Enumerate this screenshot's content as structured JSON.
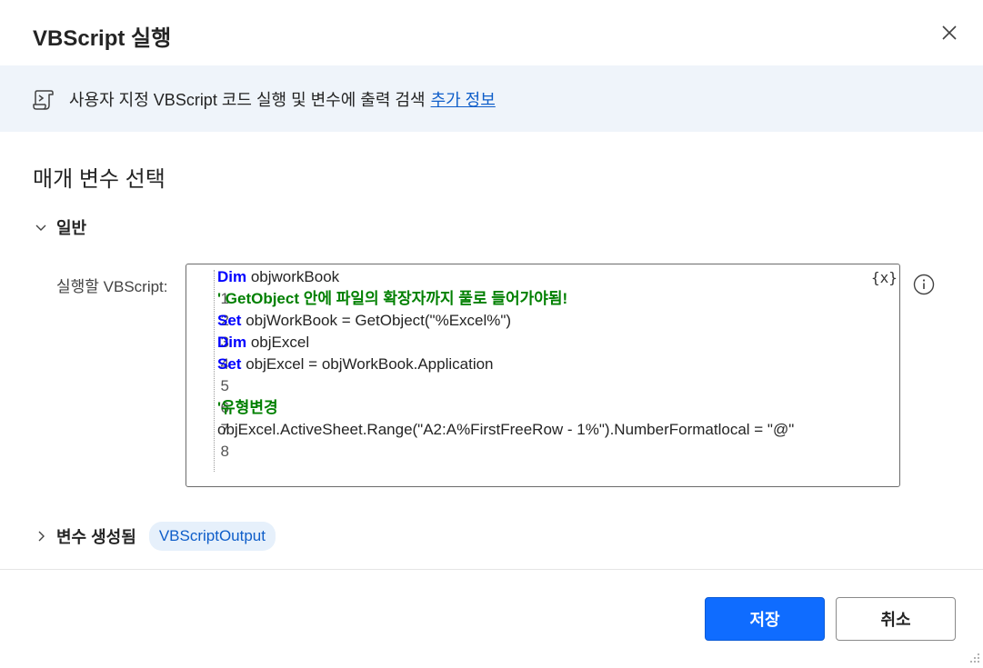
{
  "dialog": {
    "title": "VBScript 실행",
    "close_icon": "close-icon"
  },
  "info": {
    "icon": "script-icon",
    "text": "사용자 지정 VBScript 코드 실행 및 변수에 출력 검색",
    "link": "추가 정보"
  },
  "section_title": "매개 변수 선택",
  "general": {
    "label": "일반",
    "expanded": true,
    "field_label": "실행할 VBScript:",
    "variable_button": "{x}",
    "help_icon": "info-icon",
    "code_lines": [
      {
        "num": "1",
        "kw": "Dim",
        "rest": " objworkBook",
        "comment": ""
      },
      {
        "num": "2",
        "kw": "",
        "rest": "",
        "comment": "' GetObject 안에 파일의 확장자까지 풀로 들어가야됨!"
      },
      {
        "num": "3",
        "kw": "Set",
        "rest": " objWorkBook = GetObject(\"%Excel%\")",
        "comment": ""
      },
      {
        "num": "4",
        "kw": "Dim",
        "rest": " objExcel",
        "comment": ""
      },
      {
        "num": "5",
        "kw": "Set",
        "rest": " objExcel = objWorkBook.Application",
        "comment": ""
      },
      {
        "num": "6",
        "kw": "",
        "rest": "",
        "comment": ""
      },
      {
        "num": "7",
        "kw": "",
        "rest": "",
        "comment": "'유형변경"
      },
      {
        "num": "8",
        "kw": "",
        "rest": "objExcel.ActiveSheet.Range(\"A2:A%FirstFreeRow - 1%\").NumberFormatlocal = \"@\"",
        "comment": ""
      }
    ]
  },
  "variables": {
    "label": "변수 생성됨",
    "expanded": false,
    "chip": "VBScriptOutput"
  },
  "buttons": {
    "save": "저장",
    "cancel": "취소"
  },
  "colors": {
    "primary": "#0f6cff",
    "link": "#0f5ec9",
    "keyword": "#0000ff",
    "comment": "#008000",
    "info_bg": "#eff4fa"
  }
}
